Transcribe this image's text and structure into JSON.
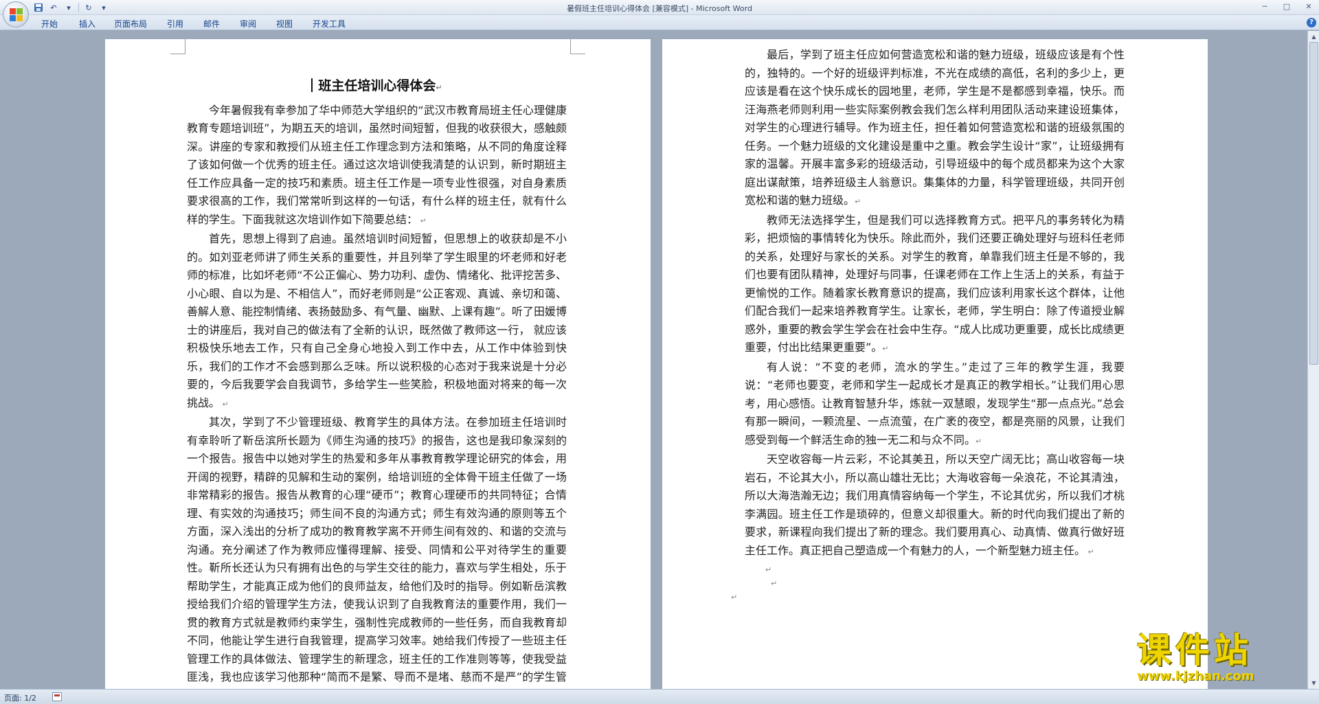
{
  "window": {
    "title": "暑假班主任培训心得体会 [兼容模式] - Microsoft Word"
  },
  "ribbon": {
    "tabs": [
      "开始",
      "插入",
      "页面布局",
      "引用",
      "邮件",
      "审阅",
      "视图",
      "开发工具"
    ]
  },
  "document": {
    "title": "班主任培训心得体会",
    "left_page": [
      "今年暑假我有幸参加了华中师范大学组织的“武汉市教育局班主任心理健康教育专题培训班”，为期五天的培训，虽然时间短暂，但我的收获很大，感触颇深。讲座的专家和教授们从班主任工作理念到方法和策略，从不同的角度诠释了该如何做一个优秀的班主任。通过这次培训使我清楚的认识到，新时期班主任工作应具备一定的技巧和素质。班主任工作是一项专业性很强，对自身素质要求很高的工作，我们常常听到这样的一句话，有什么样的班主任，就有什么样的学生。下面我就这次培训作如下简要总结：",
      "首先，思想上得到了启迪。虽然培训时间短暂，但思想上的收获却是不小的。如刘亚老师讲了师生关系的重要性，并且列举了学生眼里的坏老师和好老师的标准，比如坏老师“不公正偏心、势力功利、虚伪、情绪化、批评挖苦多、小心眼、自以为是、不相信人”，而好老师则是“公正客观、真诚、亲切和蔼、善解人意、能控制情绪、表扬鼓励多、有气量、幽默、上课有趣”。听了田媛博士的讲座后，我对自己的做法有了全新的认识，既然做了教师这一行，  就应该积极快乐地去工作，只有自己全身心地投入到工作中去，从工作中体验到快乐，我们的工作才不会感到那么乏味。所以说积极的心态对于我来说是十分必要的，今后我要学会自我调节，多给学生一些笑脸，积极地面对将来的每一次挑战。",
      "其次，学到了不少管理班级、教育学生的具体方法。在参加班主任培训时有幸聆听了靳岳滨所长题为《师生沟通的技巧》的报告，这也是我印象深刻的一个报告。报告中以她对学生的热爱和多年从事教育教学理论研究的体会，用开阔的视野，精辟的见解和生动的案例，给培训班的全体骨干班主任做了一场非常精彩的报告。报告从教育的心理“硬币”；教育心理硬币的共同特征；合情理、有实效的沟通技巧；师生间不良的沟通方式；师生有效沟通的原则等五个方面，深入浅出的分析了成功的教育教学离不开师生间有效的、和谐的交流与沟通。充分阐述了作为教师应懂得理解、接受、同情和公平对待学生的重要性。靳所长还认为只有拥有出色的与学生交往的能力，喜欢与学生相处，乐于帮助学生，才能真正成为他们的良师益友，给他们及时的指导。例如靳岳滨教授给我们介绍的管理学生方法，使我认识到了自我教育法的重要作用，我们一贯的教育方式就是教师约束学生，强制性完成教师的一些任务，而自我教育却不同，他能让学生进行自我管理，提高学习效率。她给我们传授了一些班主任管理工作的具体做法、管理学生的新理念，班主任的工作准则等等，使我受益匪浅，我也应该学习他那种“简而不是繁、导而不是堵、慈而不是严”的学生管理理念，与学生增进交流，尊重学生，宽容学生，善于运用表扬与激励的方法促进学生的发展。"
    ],
    "right_page": [
      "最后，学到了班主任应如何营造宽松和谐的魅力班级，班级应该是有个性的，独特的。一个好的班级评判标准，不光在成绩的高低，名利的多少上，更应该是看在这个快乐成长的园地里，老师，学生是不是都感到幸福，快乐。而汪海燕老师则利用一些实际案例教会我们怎么样利用团队活动来建设班集体，对学生的心理进行辅导。作为班主任，担任着如何营造宽松和谐的班级氛围的任务。一个魅力班级的文化建设是重中之重。教会学生设计“家”，让班级拥有家的温馨。开展丰富多彩的班级活动，引导班级中的每个成员都来为这个大家庭出谋献策，培养班级主人翁意识。集集体的力量，科学管理班级，共同开创宽松和谐的魅力班级。",
      "教师无法选择学生，但是我们可以选择教育方式。把平凡的事务转化为精彩，把烦恼的事情转化为快乐。除此而外，我们还要正确处理好与班科任老师的关系，处理好与家长的关系。对学生的教育，单靠我们班主任是不够的，我们也要有团队精神，处理好与同事，任课老师在工作上生活上的关系，有益于更愉悦的工作。随着家长教育意识的提高，我们应该利用家长这个群体，让他们配合我们一起来培养教育学生。让家长，老师，学生明白：除了传道授业解惑外，重要的教会学生学会在社会中生存。“成人比成功更重要，成长比成绩更重要，付出比结果更重要”。",
      "有人说：“不变的老师，流水的学生。”走过了三年的教学生涯，我要说：“老师也要变，老师和学生一起成长才是真正的教学相长。”让我们用心思考，用心感悟。让教育智慧升华，炼就一双慧眼，发现学生“那一点点光。”总会有那一瞬间，一颗流星、一点流萤，在广袤的夜空，都是亮丽的风景，让我们感受到每一个鲜活生命的独一无二和与众不同。",
      "天空收容每一片云彩，不论其美丑，所以天空广阔无比；高山收容每一块岩石，不论其大小，所以高山雄壮无比；大海收容每一朵浪花，不论其清浊，所以大海浩瀚无边；我们用真情容纳每一个学生，不论其优劣，所以我们才桃李满园。班主任工作是琐碎的，但意义却很重大。新的时代向我们提出了新的要求，新课程向我们提出了新的理念。我们要用真心、动真情、做真行做好班主任工作。真正把自己塑造成一个有魅力的人，一个新型魅力班主任。"
    ]
  },
  "status": {
    "page": "页面: 1/2"
  },
  "watermark": {
    "main": "课件站",
    "url": "www.kjzhan.com"
  },
  "icons": {
    "save": "save-icon",
    "undo": "undo-icon",
    "redo": "redo-icon",
    "customize": "dropdown-icon",
    "help": "help-icon"
  },
  "colors": {
    "ribbon_text": "#15428b",
    "workspace_bg": "#9ba9bb",
    "watermark": "#f0d400"
  }
}
